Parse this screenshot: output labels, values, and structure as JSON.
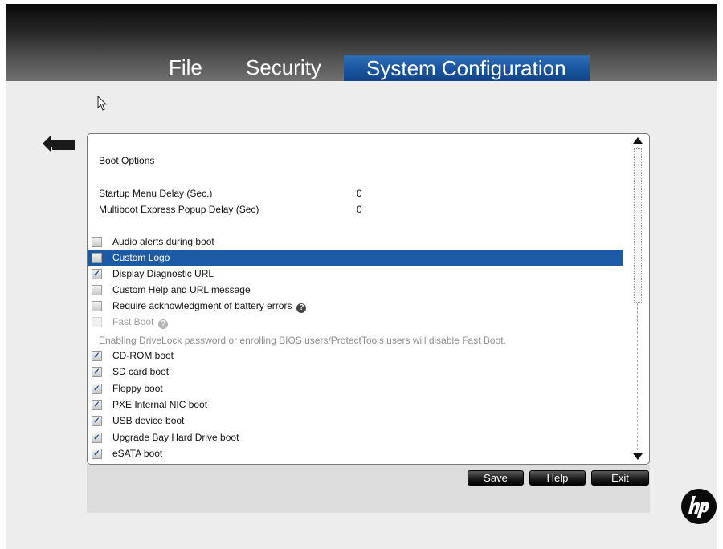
{
  "menu": {
    "file": "File",
    "security": "Security",
    "system_configuration": "System Configuration"
  },
  "panel": {
    "section_title": "Boot Options",
    "startup_delay_label": "Startup Menu Delay (Sec.)",
    "startup_delay_value": "0",
    "multiboot_delay_label": "Multiboot Express Popup Delay (Sec)",
    "multiboot_delay_value": "0",
    "options": [
      {
        "label": "Audio alerts during boot",
        "checked": false
      },
      {
        "label": "Custom Logo",
        "checked": false,
        "selected": true
      },
      {
        "label": "Display Diagnostic URL",
        "checked": true
      },
      {
        "label": "Custom Help and URL message",
        "checked": false
      },
      {
        "label": "Require acknowledgment of battery errors",
        "checked": false,
        "help": true
      },
      {
        "label": "Fast Boot",
        "checked": false,
        "disabled": true,
        "help": true
      }
    ],
    "fast_boot_note": "Enabling DriveLock password or enrolling BIOS users/ProtectTools users will disable Fast Boot.",
    "boot_devices": [
      {
        "label": "CD-ROM boot",
        "checked": true
      },
      {
        "label": "SD card boot",
        "checked": true
      },
      {
        "label": "Floppy boot",
        "checked": true
      },
      {
        "label": "PXE Internal NIC boot",
        "checked": true
      },
      {
        "label": "USB device boot",
        "checked": true
      },
      {
        "label": "Upgrade Bay Hard Drive boot",
        "checked": true
      },
      {
        "label": "eSATA boot",
        "checked": true
      }
    ]
  },
  "buttons": {
    "save": "Save",
    "help": "Help",
    "exit": "Exit"
  },
  "colors": {
    "active_tab": "#17529a",
    "selected_row": "#1c5aa6",
    "background": "#ededed"
  },
  "icons": {
    "cursor": "mouse-pointer-icon",
    "back": "back-arrow-icon",
    "help": "question-icon",
    "logo": "hp-logo"
  }
}
